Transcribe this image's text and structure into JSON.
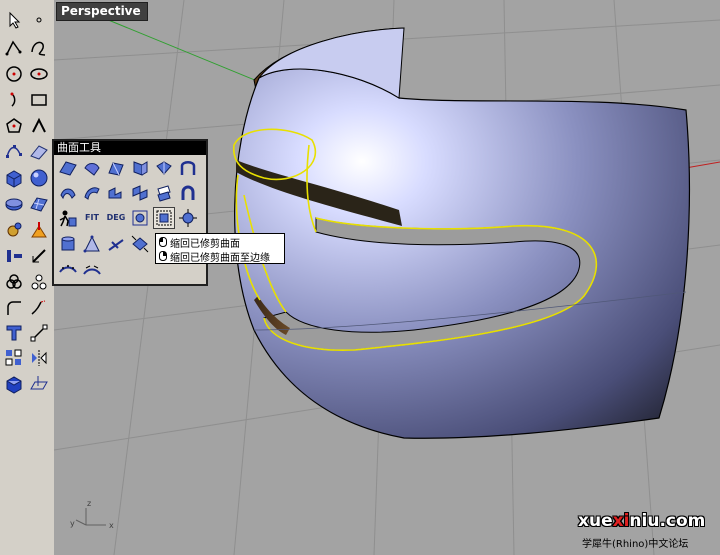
{
  "viewport": {
    "title": "Perspective",
    "axis_labels": {
      "x": "x",
      "y": "y",
      "z": "z"
    }
  },
  "surface_toolbar": {
    "title": "曲面工具",
    "fit_label": "FIT",
    "deg_label": "DEG"
  },
  "tooltip": {
    "line1": "缩回已修剪曲面",
    "line2": "缩回已修剪曲面至边缘"
  },
  "watermark": {
    "main_a": "xue",
    "main_b": "xi",
    "main_c": "niu.com",
    "sub": "学犀牛(Rhino)中文论坛"
  },
  "colors": {
    "viewport_bg": "#a3a3a3",
    "toolbar_bg": "#d4d0c8",
    "selection_yellow": "#e8e000",
    "surface_blue": "#8c93c8",
    "interior_brown": "#7a5530"
  }
}
